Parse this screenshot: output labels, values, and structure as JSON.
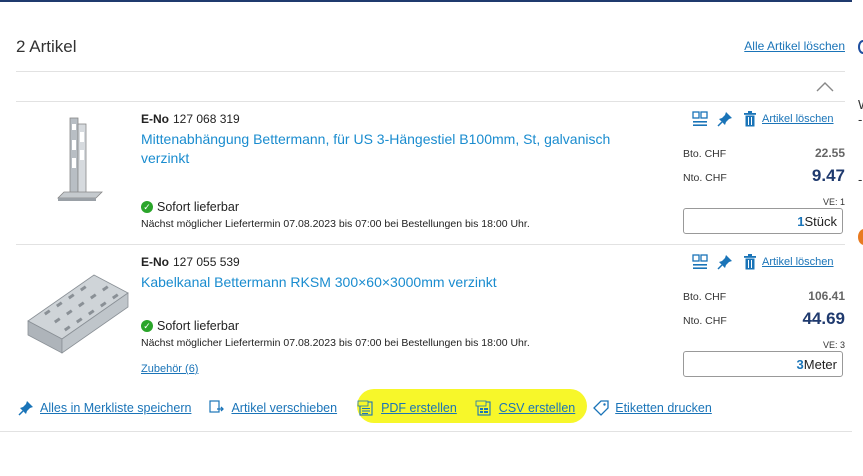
{
  "header": {
    "count": "2 Artikel",
    "delete_all": "Alle Artikel löschen"
  },
  "items": [
    {
      "eno_label": "E-No",
      "eno": "127 068 319",
      "title": "Mittenabhängung Bettermann, für US 3-Hängestiel B100mm, St, galvanisch verzinkt",
      "availability": "Sofort lieferbar",
      "delivery": "Nächst möglicher Liefertermin 07.08.2023 bis 07:00 bei Bestellungen bis 18:00 Uhr.",
      "delete": "Artikel löschen",
      "gross_label": "Bto. CHF",
      "gross": "22.55",
      "net_label": "Nto. CHF",
      "net": "9.47",
      "ve": "VE: 1",
      "qty": "1",
      "unit": "Stück"
    },
    {
      "eno_label": "E-No",
      "eno": "127 055 539",
      "title": "Kabelkanal Bettermann RKSM 300×60×3000mm verzinkt",
      "availability": "Sofort lieferbar",
      "delivery": "Nächst möglicher Liefertermin 07.08.2023 bis 07:00 bei Bestellungen bis 18:00 Uhr.",
      "accessories": "Zubehör (6)",
      "delete": "Artikel löschen",
      "gross_label": "Bto. CHF",
      "gross": "106.41",
      "net_label": "Nto. CHF",
      "net": "44.69",
      "ve": "VE: 3",
      "qty": "3",
      "unit": "Meter"
    }
  ],
  "actions": {
    "save_list": "Alles in Merkliste speichern",
    "move": "Artikel verschieben",
    "pdf": "PDF erstellen",
    "csv": "CSV erstellen",
    "labels": "Etiketten drucken"
  },
  "edge": {
    "a": "W",
    "b": "-",
    "c": "-"
  },
  "colors": {
    "link": "#1a74b8",
    "title": "#1a8ccf",
    "net_price": "#1f3a6e",
    "highlight": "#f7f72a",
    "available": "#2aa52a"
  },
  "icons": [
    "compare-icon",
    "pin-icon",
    "trash-icon",
    "check-icon",
    "pdf-icon",
    "csv-icon",
    "move-icon",
    "tag-icon",
    "chevron-up-icon"
  ]
}
